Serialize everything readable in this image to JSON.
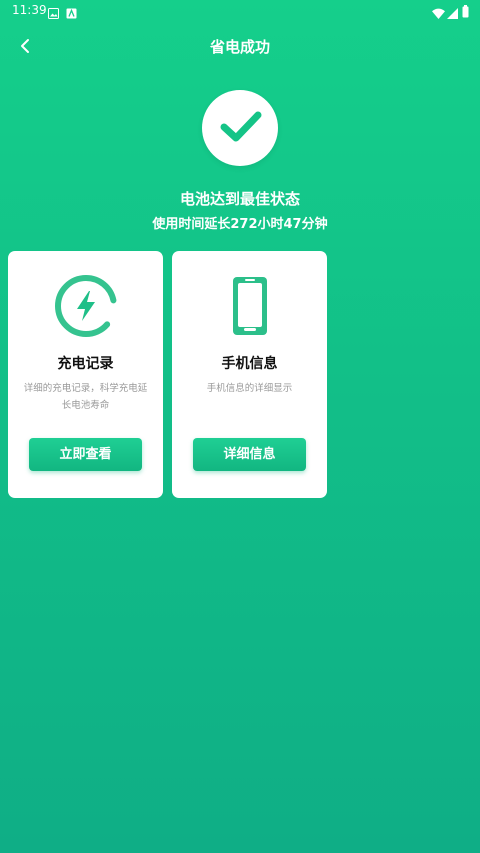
{
  "status_bar": {
    "time": "11:39"
  },
  "header": {
    "title": "省电成功"
  },
  "result": {
    "headline": "电池达到最佳状态",
    "subline": "使用时间延长272小时47分钟"
  },
  "cards": [
    {
      "title": "充电记录",
      "desc": "详细的充电记录，科学充电延长电池寿命",
      "button": "立即查看",
      "icon": "charge-bolt-icon"
    },
    {
      "title": "手机信息",
      "desc": "手机信息的详细显示",
      "button": "详细信息",
      "icon": "phone-icon"
    }
  ],
  "colors": {
    "accent": "#15cf8b",
    "accent_dark": "#12b681",
    "card_bg": "#ffffff"
  }
}
